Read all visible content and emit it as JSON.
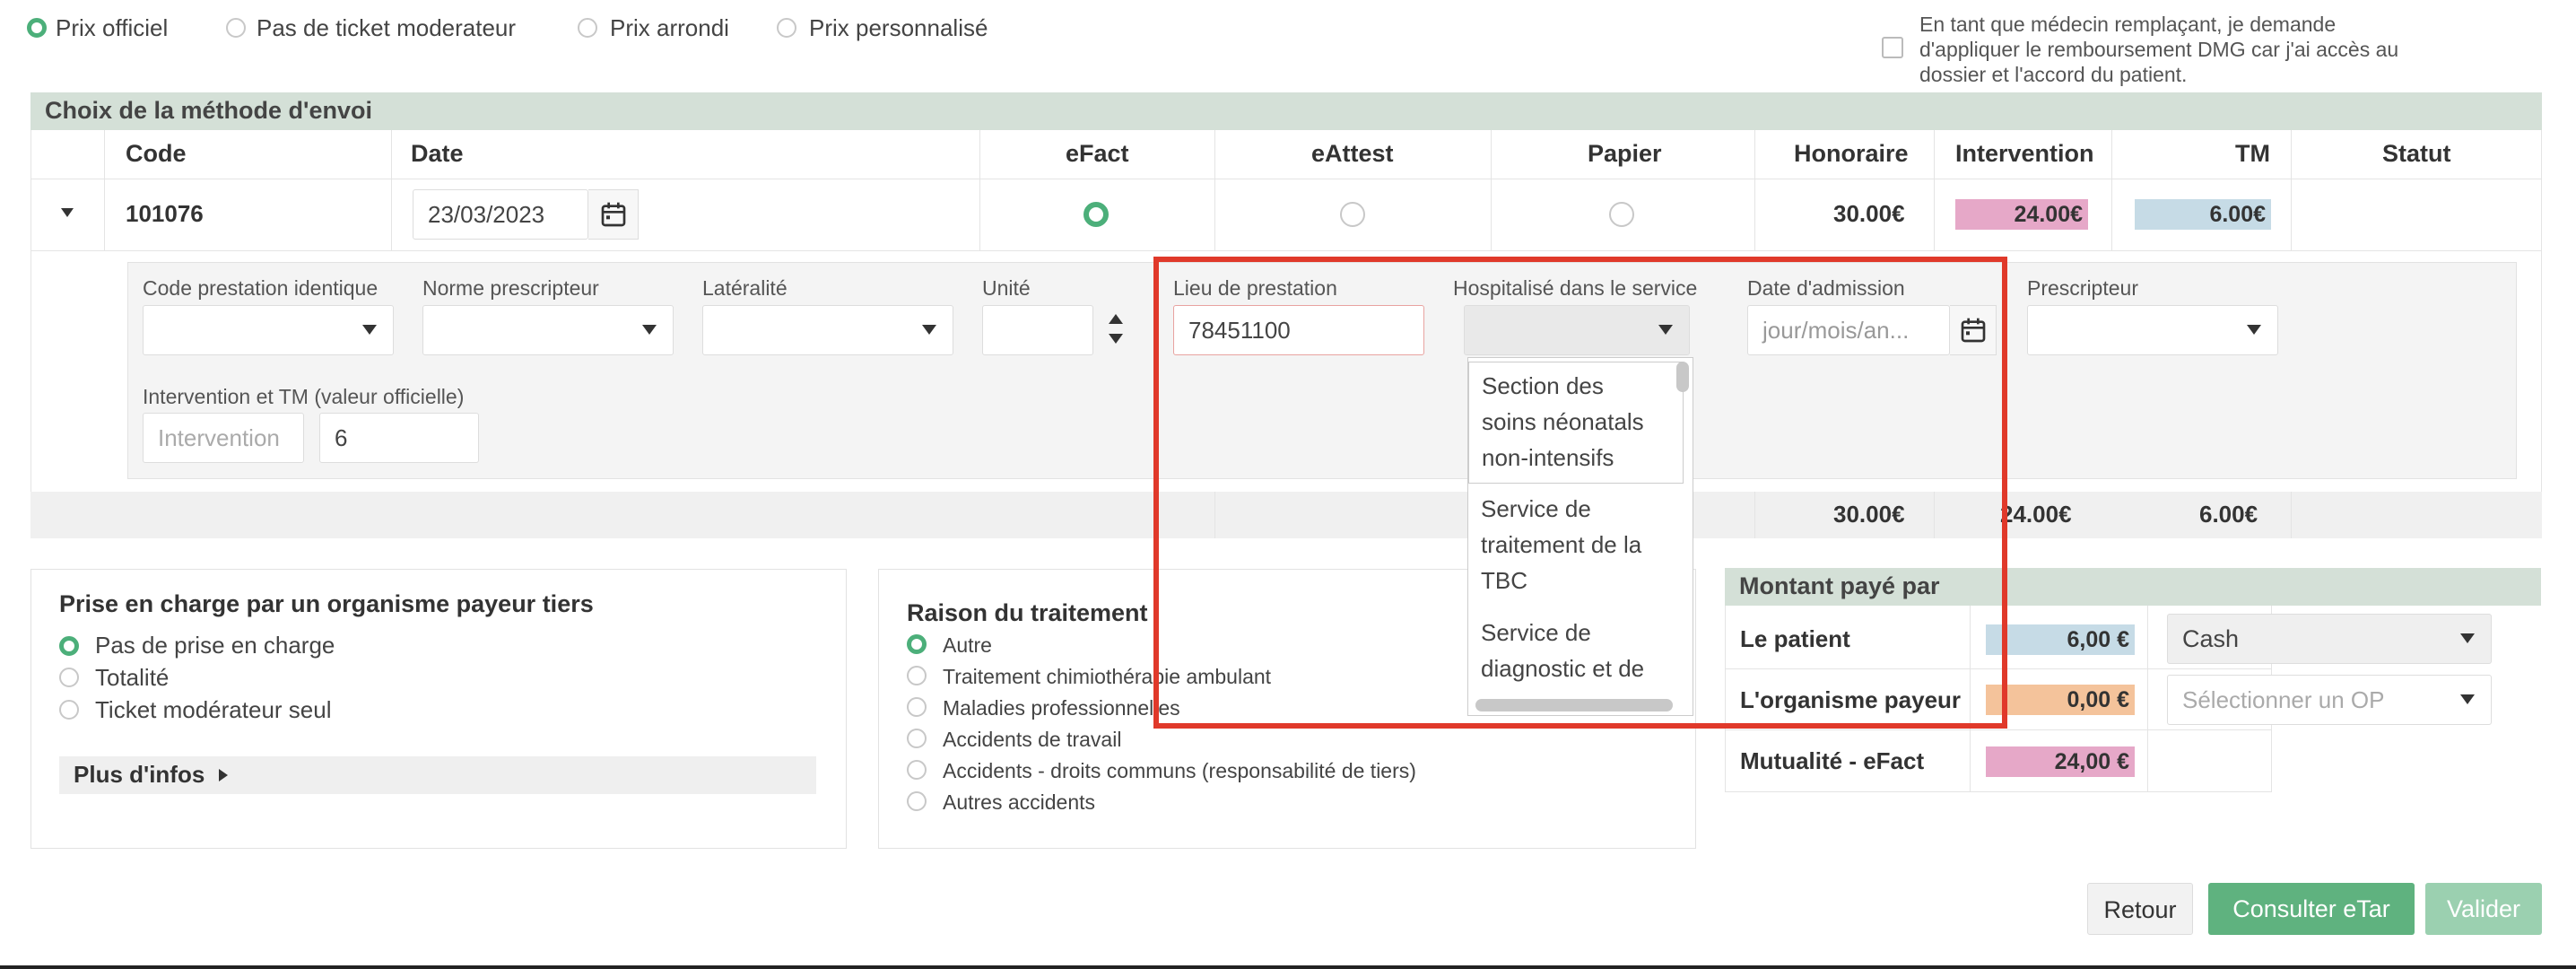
{
  "price_options": [
    {
      "label": "Prix officiel",
      "selected": true
    },
    {
      "label": "Pas de ticket moderateur",
      "selected": false
    },
    {
      "label": "Prix arrondi",
      "selected": false
    },
    {
      "label": "Prix personnalisé",
      "selected": false
    }
  ],
  "dmg_notice": {
    "line1": "En tant que médecin remplaçant, je demande",
    "line2": "d'appliquer le remboursement DMG car j'ai accès au",
    "line3": "dossier et l'accord du patient."
  },
  "send_method": {
    "title": "Choix de la méthode d'envoi",
    "columns": [
      "Code",
      "Date",
      "eFact",
      "eAttest",
      "Papier",
      "Honoraire",
      "Intervention",
      "TM",
      "Statut"
    ],
    "row": {
      "code": "101076",
      "date": "23/03/2023",
      "honoraire": "30.00€",
      "intervention": "24.00€",
      "tm": "6.00€",
      "method": "eFact"
    },
    "totals": {
      "honoraire": "30.00€",
      "intervention": "24.00€",
      "tm": "6.00€"
    }
  },
  "detail": {
    "code_identique": "Code prestation identique",
    "norme": "Norme prescripteur",
    "lateralite": "Latéralité",
    "unite": "Unité",
    "lieu": "Lieu de prestation",
    "lieu_value": "78451100",
    "hospitalise": "Hospitalisé dans le service",
    "date_admission": "Date d'admission",
    "date_admission_placeholder": "jour/mois/an...",
    "prescripteur": "Prescripteur",
    "intervention_tm": "Intervention et TM (valeur officielle)",
    "intervention_placeholder": "Intervention",
    "tm_value": "6"
  },
  "hospital_dropdown": {
    "items": [
      [
        "Section des",
        "soins néonatals",
        "non-intensifs"
      ],
      [
        "Service de",
        "traitement de la",
        "TBC"
      ],
      [
        "Service de",
        "diagnostic et de"
      ]
    ]
  },
  "payer": {
    "title": "Prise en charge par un organisme payeur tiers",
    "options": [
      {
        "label": "Pas de prise en charge",
        "selected": true
      },
      {
        "label": "Totalité",
        "selected": false
      },
      {
        "label": "Ticket modérateur seul",
        "selected": false
      }
    ],
    "more": "Plus d'infos"
  },
  "reason": {
    "title": "Raison du traitement",
    "options": [
      {
        "label": "Autre",
        "selected": true
      },
      {
        "label": "Traitement chimiothérapie ambulant",
        "selected": false
      },
      {
        "label": "Maladies professionnelles",
        "selected": false
      },
      {
        "label": "Accidents de travail",
        "selected": false
      },
      {
        "label": "Accidents - droits communs (responsabilité de tiers)",
        "selected": false
      },
      {
        "label": "Autres accidents",
        "selected": false
      }
    ]
  },
  "paid_by": {
    "title": "Montant payé par",
    "rows": [
      {
        "label": "Le patient",
        "amount": "6,00 €",
        "select": "Cash",
        "color": "#c6dbe6"
      },
      {
        "label": "L'organisme payeur",
        "amount": "0,00 €",
        "select": "Sélectionner un OP",
        "color": "#f4c39b"
      },
      {
        "label": "Mutualité - eFact",
        "amount": "24,00 €",
        "select": "",
        "color": "#e6a8c8"
      }
    ]
  },
  "buttons": {
    "retour": "Retour",
    "consulter": "Consulter eTar",
    "valider": "Valider"
  },
  "colors": {
    "accent": "#4caf7a",
    "header_bg": "#d4e0d7",
    "highlight": "#e0392a",
    "intervention": "#e6a8c8",
    "tm": "#c6dbe6"
  }
}
